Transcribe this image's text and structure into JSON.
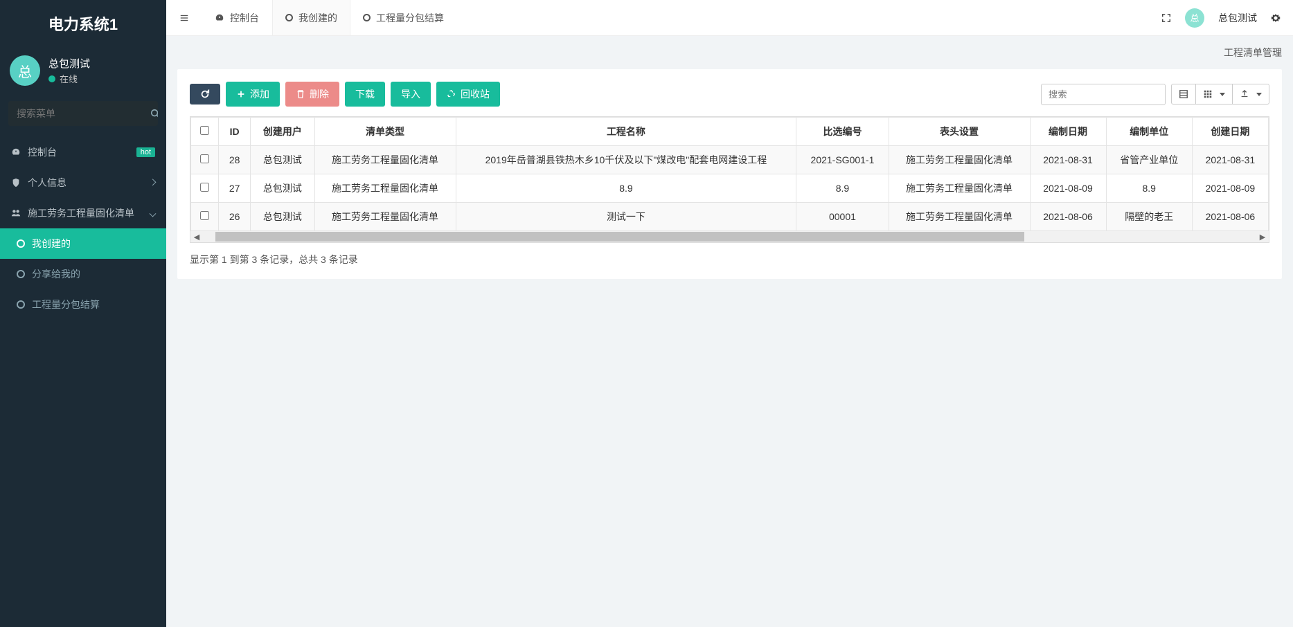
{
  "app": {
    "title": "电力系统1"
  },
  "user": {
    "avatar_text": "总",
    "name": "总包测试",
    "status": "在线"
  },
  "sidebar": {
    "search_placeholder": "搜索菜单",
    "items": [
      {
        "label": "控制台",
        "badge": "hot"
      },
      {
        "label": "个人信息"
      },
      {
        "label": "施工劳务工程量固化清单"
      }
    ],
    "submenu": [
      {
        "label": "我创建的"
      },
      {
        "label": "分享给我的"
      },
      {
        "label": "工程量分包结算"
      }
    ]
  },
  "tabs": [
    {
      "label": "控制台",
      "icon": "dashboard"
    },
    {
      "label": "我创建的",
      "icon": "circle",
      "active": true
    },
    {
      "label": "工程量分包结算",
      "icon": "circle"
    }
  ],
  "topbar_user": "总包测试",
  "topbar_avatar": "总",
  "breadcrumb": "工程清单管理",
  "toolbar": {
    "add": "添加",
    "delete": "删除",
    "download": "下载",
    "import": "导入",
    "recycle": "回收站"
  },
  "table": {
    "search_placeholder": "搜索",
    "headers": [
      "ID",
      "创建用户",
      "清单类型",
      "工程名称",
      "比选编号",
      "表头设置",
      "编制日期",
      "编制单位",
      "创建日期"
    ],
    "rows": [
      {
        "id": "28",
        "user": "总包测试",
        "type": "施工劳务工程量固化清单",
        "project": "2019年岳普湖县铁热木乡10千伏及以下\"煤改电\"配套电网建设工程",
        "bid": "2021-SG001-1",
        "header": "施工劳务工程量固化清单",
        "date1": "2021-08-31",
        "unit": "省管产业单位",
        "date2": "2021-08-31"
      },
      {
        "id": "27",
        "user": "总包测试",
        "type": "施工劳务工程量固化清单",
        "project": "8.9",
        "bid": "8.9",
        "header": "施工劳务工程量固化清单",
        "date1": "2021-08-09",
        "unit": "8.9",
        "date2": "2021-08-09"
      },
      {
        "id": "26",
        "user": "总包测试",
        "type": "施工劳务工程量固化清单",
        "project": "测试一下",
        "bid": "00001",
        "header": "施工劳务工程量固化清单",
        "date1": "2021-08-06",
        "unit": "隔壁的老王",
        "date2": "2021-08-06"
      }
    ]
  },
  "pagination": "显示第 1 到第 3 条记录，总共 3 条记录"
}
